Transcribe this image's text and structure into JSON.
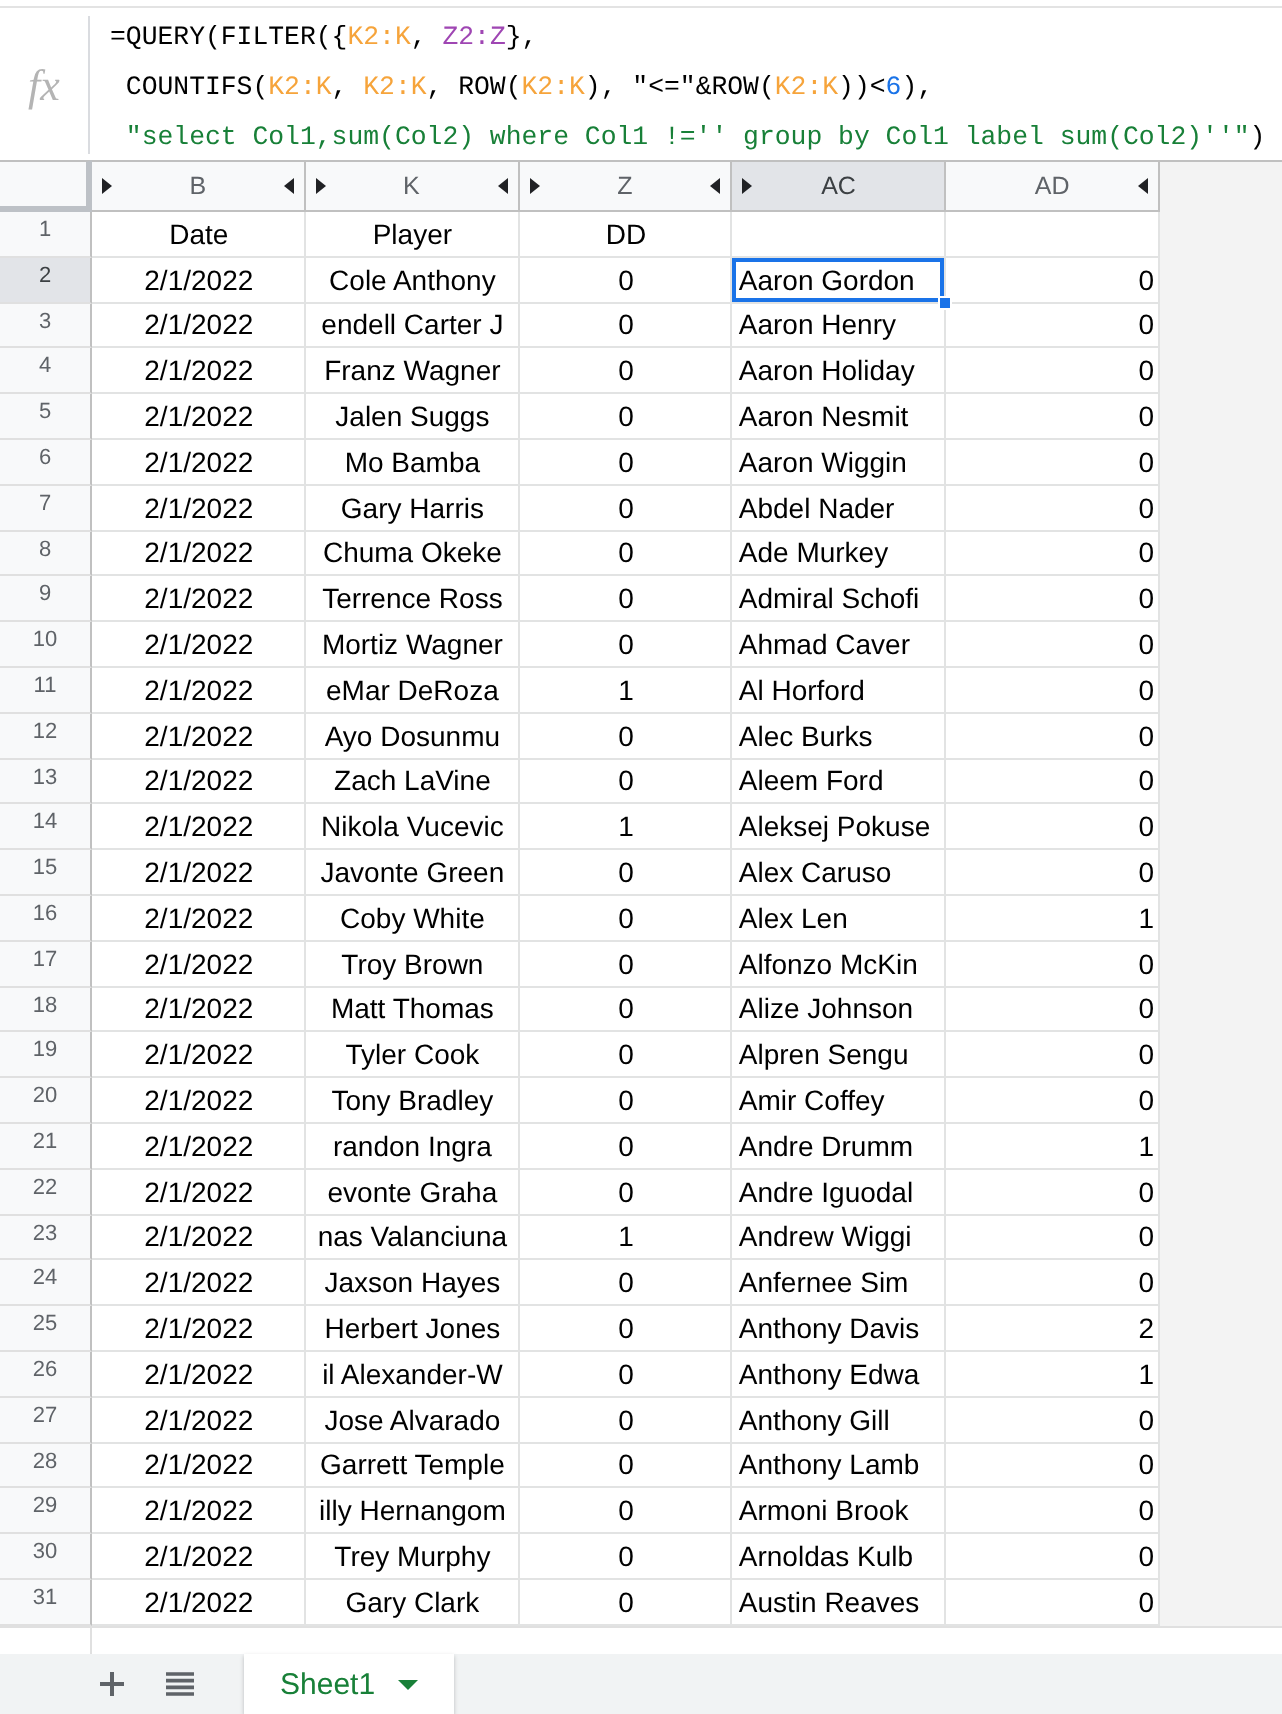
{
  "formula_bar": {
    "label": "fx",
    "lines": [
      {
        "segments": [
          {
            "kind": "text",
            "text": "=QUERY(FILTER({"
          },
          {
            "kind": "ref",
            "text": "K2:K",
            "color": "#f6a43b"
          },
          {
            "kind": "text",
            "text": ", "
          },
          {
            "kind": "ref",
            "text": "Z2:Z",
            "color": "#9f46b3"
          },
          {
            "kind": "text",
            "text": "},"
          }
        ]
      },
      {
        "segments": [
          {
            "kind": "text",
            "text": " COUNTIFS("
          },
          {
            "kind": "ref",
            "text": "K2:K",
            "color": "#f6a43b"
          },
          {
            "kind": "text",
            "text": ", "
          },
          {
            "kind": "ref",
            "text": "K2:K",
            "color": "#f6a43b"
          },
          {
            "kind": "text",
            "text": ", ROW("
          },
          {
            "kind": "ref",
            "text": "K2:K",
            "color": "#f6a43b"
          },
          {
            "kind": "text",
            "text": "), \"<=\"&ROW("
          },
          {
            "kind": "ref",
            "text": "K2:K",
            "color": "#f6a43b"
          },
          {
            "kind": "text",
            "text": "))<"
          },
          {
            "kind": "number",
            "text": "6"
          },
          {
            "kind": "text",
            "text": "),"
          }
        ]
      },
      {
        "segments": [
          {
            "kind": "string",
            "text": " \"select Col1,sum(Col2) where Col1 !='' group by Col1 label sum(Col2)''\""
          },
          {
            "kind": "text",
            "text": ")"
          }
        ]
      }
    ]
  },
  "columns": [
    {
      "label": "B",
      "selected": false,
      "hidden_before": true,
      "hidden_after": true
    },
    {
      "label": "K",
      "selected": false,
      "hidden_before": true,
      "hidden_after": true
    },
    {
      "label": "Z",
      "selected": false,
      "hidden_before": true,
      "hidden_after": true
    },
    {
      "label": "AC",
      "selected": true,
      "hidden_before": true,
      "hidden_after": false
    },
    {
      "label": "AD",
      "selected": false,
      "hidden_before": false,
      "hidden_after": true
    }
  ],
  "rows": [
    {
      "number": "1",
      "selected": false,
      "cells": [
        "Date",
        "Player",
        "DD"
      ]
    },
    {
      "number": "2",
      "selected": true,
      "cells": [
        "2/1/2022",
        "Cole Anthony",
        "0",
        "Aaron Gordon",
        "0"
      ]
    },
    {
      "number": "3",
      "selected": false,
      "cells": [
        "2/1/2022",
        "endell Carter J",
        "0",
        "Aaron Henry",
        "0"
      ]
    },
    {
      "number": "4",
      "selected": false,
      "cells": [
        "2/1/2022",
        "Franz Wagner",
        "0",
        "Aaron Holiday",
        "0"
      ]
    },
    {
      "number": "5",
      "selected": false,
      "cells": [
        "2/1/2022",
        "Jalen Suggs",
        "0",
        "Aaron Nesmit",
        "0"
      ]
    },
    {
      "number": "6",
      "selected": false,
      "cells": [
        "2/1/2022",
        "Mo Bamba",
        "0",
        "Aaron Wiggin",
        "0"
      ]
    },
    {
      "number": "7",
      "selected": false,
      "cells": [
        "2/1/2022",
        "Gary Harris",
        "0",
        "Abdel Nader",
        "0"
      ]
    },
    {
      "number": "8",
      "selected": false,
      "cells": [
        "2/1/2022",
        "Chuma Okeke",
        "0",
        "Ade Murkey",
        "0"
      ]
    },
    {
      "number": "9",
      "selected": false,
      "cells": [
        "2/1/2022",
        "Terrence Ross",
        "0",
        "Admiral Schofi",
        "0"
      ]
    },
    {
      "number": "10",
      "selected": false,
      "cells": [
        "2/1/2022",
        "Mortiz Wagner",
        "0",
        "Ahmad Caver",
        "0"
      ]
    },
    {
      "number": "11",
      "selected": false,
      "cells": [
        "2/1/2022",
        "eMar DeRoza",
        "1",
        "Al Horford",
        "0"
      ]
    },
    {
      "number": "12",
      "selected": false,
      "cells": [
        "2/1/2022",
        "Ayo Dosunmu",
        "0",
        "Alec Burks",
        "0"
      ]
    },
    {
      "number": "13",
      "selected": false,
      "cells": [
        "2/1/2022",
        "Zach LaVine",
        "0",
        "Aleem Ford",
        "0"
      ]
    },
    {
      "number": "14",
      "selected": false,
      "cells": [
        "2/1/2022",
        "Nikola Vucevic",
        "1",
        "Aleksej Pokuse",
        "0"
      ]
    },
    {
      "number": "15",
      "selected": false,
      "cells": [
        "2/1/2022",
        "Javonte Green",
        "0",
        "Alex Caruso",
        "0"
      ]
    },
    {
      "number": "16",
      "selected": false,
      "cells": [
        "2/1/2022",
        "Coby White",
        "0",
        "Alex Len",
        "1"
      ]
    },
    {
      "number": "17",
      "selected": false,
      "cells": [
        "2/1/2022",
        "Troy Brown",
        "0",
        "Alfonzo McKin",
        "0"
      ]
    },
    {
      "number": "18",
      "selected": false,
      "cells": [
        "2/1/2022",
        "Matt Thomas",
        "0",
        "Alize Johnson",
        "0"
      ]
    },
    {
      "number": "19",
      "selected": false,
      "cells": [
        "2/1/2022",
        "Tyler Cook",
        "0",
        "Alpren Sengu",
        "0"
      ]
    },
    {
      "number": "20",
      "selected": false,
      "cells": [
        "2/1/2022",
        "Tony Bradley",
        "0",
        "Amir Coffey",
        "0"
      ]
    },
    {
      "number": "21",
      "selected": false,
      "cells": [
        "2/1/2022",
        "randon Ingra",
        "0",
        "Andre Drumm",
        "1"
      ]
    },
    {
      "number": "22",
      "selected": false,
      "cells": [
        "2/1/2022",
        "evonte Graha",
        "0",
        "Andre Iguodal",
        "0"
      ]
    },
    {
      "number": "23",
      "selected": false,
      "cells": [
        "2/1/2022",
        "nas Valanciuna",
        "1",
        "Andrew Wiggi",
        "0"
      ]
    },
    {
      "number": "24",
      "selected": false,
      "cells": [
        "2/1/2022",
        "Jaxson Hayes",
        "0",
        "Anfernee Sim",
        "0"
      ]
    },
    {
      "number": "25",
      "selected": false,
      "cells": [
        "2/1/2022",
        "Herbert Jones",
        "0",
        "Anthony Davis",
        "2"
      ]
    },
    {
      "number": "26",
      "selected": false,
      "cells": [
        "2/1/2022",
        "il Alexander-W",
        "0",
        "Anthony Edwa",
        "1"
      ]
    },
    {
      "number": "27",
      "selected": false,
      "cells": [
        "2/1/2022",
        "Jose Alvarado",
        "0",
        "Anthony Gill",
        "0"
      ]
    },
    {
      "number": "28",
      "selected": false,
      "cells": [
        "2/1/2022",
        "Garrett Temple",
        "0",
        "Anthony Lamb",
        "0"
      ]
    },
    {
      "number": "29",
      "selected": false,
      "cells": [
        "2/1/2022",
        "illy Hernangom",
        "0",
        "Armoni Brook",
        "0"
      ]
    },
    {
      "number": "30",
      "selected": false,
      "cells": [
        "2/1/2022",
        "Trey Murphy",
        "0",
        "Arnoldas Kulb",
        "0"
      ]
    },
    {
      "number": "31",
      "selected": false,
      "cells": [
        "2/1/2022",
        "Gary Clark",
        "0",
        "Austin Reaves",
        "0"
      ]
    }
  ],
  "sheet_tabs": [
    {
      "label": "Sheet1",
      "selected": true
    }
  ]
}
